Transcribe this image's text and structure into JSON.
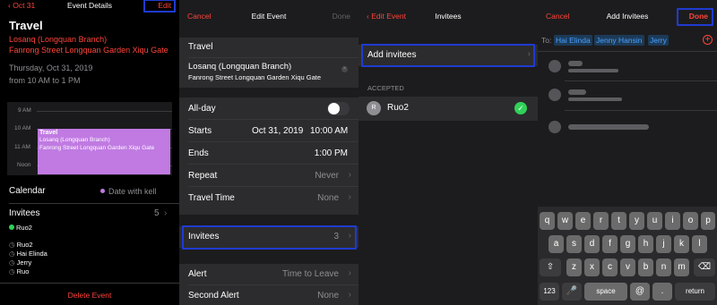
{
  "p1": {
    "back": "Oct 31",
    "title": "Event Details",
    "edit": "Edit",
    "event_title": "Travel",
    "loc1": "Losanq (Longquan Branch)",
    "loc2": "Fanrong Street Longquan Garden Xiqu Gate",
    "date": "Thursday, Oct 31, 2019",
    "time": "from 10 AM to 1 PM",
    "hours": [
      "9 AM",
      "10 AM",
      "11 AM",
      "Noon"
    ],
    "block": {
      "title": "Travel",
      "loc1": "Losanq (Longquan Branch)",
      "loc2": "Fanrong Street Longquan Garden Xiqu Gate",
      "color": "#c07ae2"
    },
    "cal_label": "Calendar",
    "cal_value": "Date with kell",
    "inv_label": "Invitees",
    "inv_count": "5",
    "accepted": "Ruo2",
    "pending": [
      "Ruo2",
      "Hai Elinda",
      "Jerry",
      "Ruo"
    ],
    "delete": "Delete Event"
  },
  "p2": {
    "cancel": "Cancel",
    "title": "Edit Event",
    "done": "Done",
    "title_field": "Travel",
    "loc1": "Losanq (Longquan Branch)",
    "loc2": "Fanrong Street Longquan Garden Xiqu Gate",
    "allday": "All-day",
    "starts": "Starts",
    "starts_date": "Oct 31, 2019",
    "starts_time": "10:00 AM",
    "ends": "Ends",
    "ends_time": "1:00 PM",
    "repeat": "Repeat",
    "repeat_val": "Never",
    "travel": "Travel Time",
    "travel_val": "None",
    "invitees": "Invitees",
    "invitees_val": "3",
    "alert": "Alert",
    "alert_val": "Time to Leave",
    "alert2": "Second Alert",
    "alert2_val": "None"
  },
  "p3": {
    "back": "Edit Event",
    "title": "Invitees",
    "add": "Add invitees",
    "section": "ACCEPTED",
    "avatar": "R",
    "name": "Ruo2"
  },
  "p4": {
    "cancel": "Cancel",
    "title": "Add Invitees",
    "done": "Done",
    "to": "To:",
    "tokens": [
      "Hai Elinda",
      "Jenny Hansin",
      "Jerry"
    ],
    "keys_row1": [
      "q",
      "w",
      "e",
      "r",
      "t",
      "y",
      "u",
      "i",
      "o",
      "p"
    ],
    "keys_row2": [
      "a",
      "s",
      "d",
      "f",
      "g",
      "h",
      "j",
      "k",
      "l"
    ],
    "keys_row3": [
      "z",
      "x",
      "c",
      "v",
      "b",
      "n",
      "m"
    ],
    "k123": "123",
    "space": "space",
    "at": "@",
    "dot": ".",
    "return": "return"
  }
}
